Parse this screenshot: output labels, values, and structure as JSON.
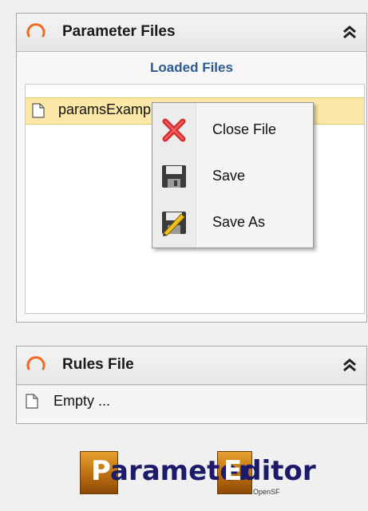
{
  "parameter_panel": {
    "title": "Parameter Files",
    "subheader": "Loaded Files",
    "files": [
      {
        "name": "paramsExample.xml"
      }
    ]
  },
  "context_menu": {
    "items": [
      {
        "label": "Close File",
        "icon": "close-icon"
      },
      {
        "label": "Save",
        "icon": "floppy-disk-icon"
      },
      {
        "label": "Save As",
        "icon": "save-as-icon"
      }
    ]
  },
  "rules_panel": {
    "title": "Rules File",
    "empty_text": "Empty ..."
  },
  "logo": {
    "text": "ParameterEditor",
    "subtext": "OpenSF"
  },
  "colors": {
    "selection": "#fbe7a6",
    "subheader_text": "#2b5b8f",
    "spinner": "#f26a21",
    "logo_orange": "#c6781a",
    "logo_blue": "#1b1b6a"
  }
}
